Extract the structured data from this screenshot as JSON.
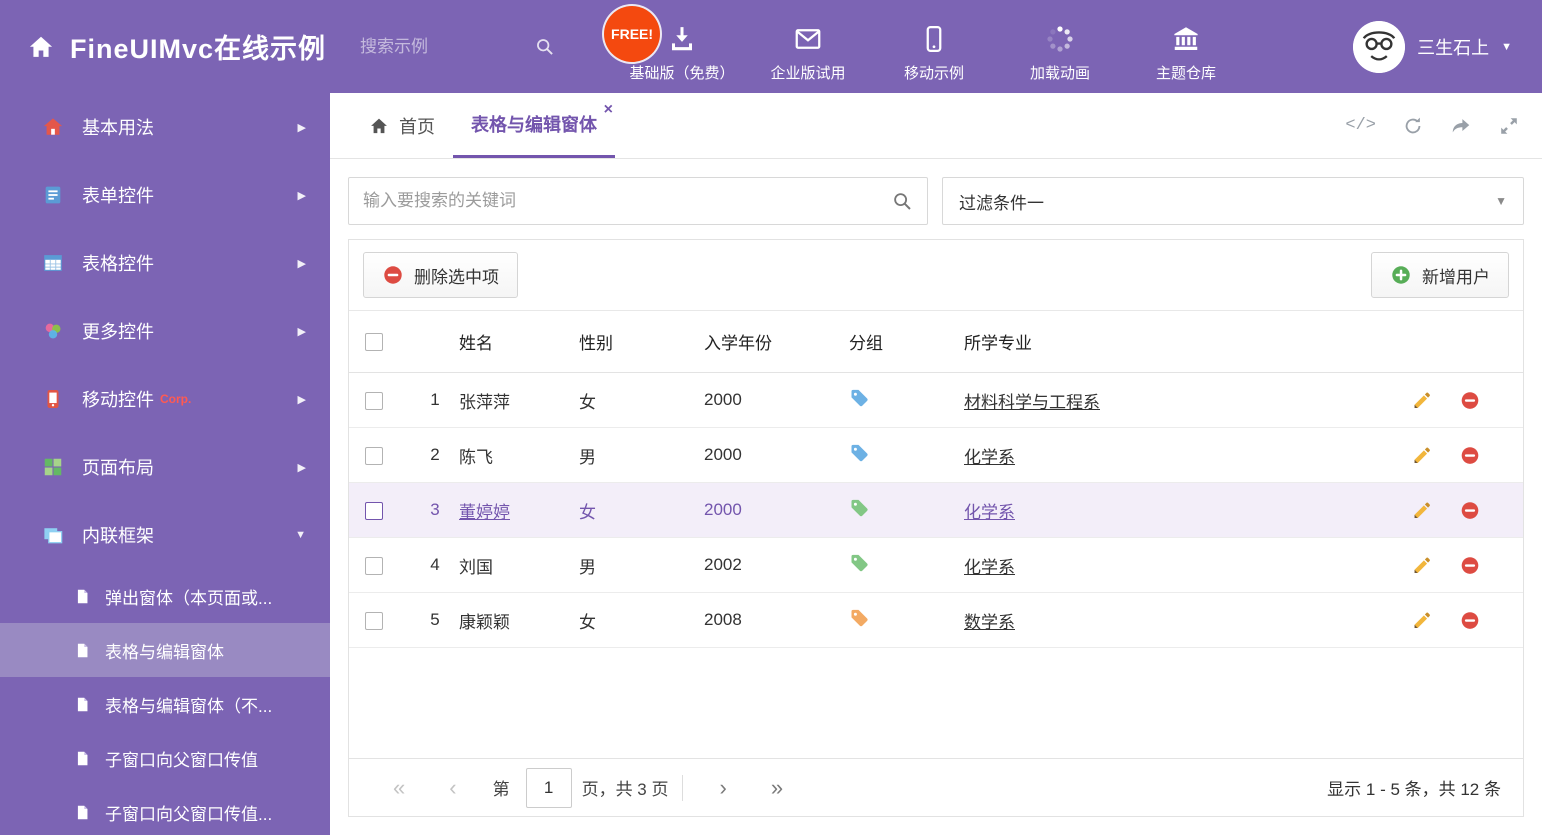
{
  "header": {
    "title": "FineUIMvc在线示例",
    "search_placeholder": "搜索示例",
    "free_badge": "FREE!",
    "nav": [
      {
        "label": "基础版（免费）",
        "icon": "download-icon"
      },
      {
        "label": "企业版试用",
        "icon": "envelope-icon"
      },
      {
        "label": "移动示例",
        "icon": "mobile-icon"
      },
      {
        "label": "加载动画",
        "icon": "spinner-icon"
      },
      {
        "label": "主题仓库",
        "icon": "bank-icon"
      }
    ],
    "user_name": "三生石上"
  },
  "sidebar": {
    "items": [
      {
        "label": "基本用法"
      },
      {
        "label": "表单控件"
      },
      {
        "label": "表格控件"
      },
      {
        "label": "更多控件"
      },
      {
        "label": "移动控件",
        "badge": "Corp."
      },
      {
        "label": "页面布局"
      },
      {
        "label": "内联框架"
      }
    ],
    "subitems": [
      {
        "label": "弹出窗体（本页面或..."
      },
      {
        "label": "表格与编辑窗体"
      },
      {
        "label": "表格与编辑窗体（不..."
      },
      {
        "label": "子窗口向父窗口传值"
      },
      {
        "label": "子窗口向父窗口传值..."
      }
    ]
  },
  "tabs": {
    "home_label": "首页",
    "active_label": "表格与编辑窗体"
  },
  "icons": {
    "close": "×",
    "code": "</>",
    "caret_down": "▼",
    "chevron_right": "▶"
  },
  "filter": {
    "search_placeholder": "输入要搜索的关键词",
    "dropdown_value": "过滤条件一"
  },
  "toolbar": {
    "delete_label": "删除选中项",
    "add_label": "新增用户"
  },
  "table": {
    "headers": {
      "name": "姓名",
      "gender": "性别",
      "year": "入学年份",
      "group": "分组",
      "major": "所学专业"
    },
    "rows": [
      {
        "num": "1",
        "name": "张萍萍",
        "gender": "女",
        "year": "2000",
        "major": "材料科学与工程系",
        "tag_color": "#6db1e4",
        "selected": false
      },
      {
        "num": "2",
        "name": "陈飞",
        "gender": "男",
        "year": "2000",
        "major": "化学系",
        "tag_color": "#6db1e4",
        "selected": false
      },
      {
        "num": "3",
        "name": "董婷婷",
        "gender": "女",
        "year": "2000",
        "major": "化学系",
        "tag_color": "#82c785",
        "selected": true
      },
      {
        "num": "4",
        "name": "刘国",
        "gender": "男",
        "year": "2002",
        "major": "化学系",
        "tag_color": "#82c785",
        "selected": false
      },
      {
        "num": "5",
        "name": "康颖颖",
        "gender": "女",
        "year": "2008",
        "major": "数学系",
        "tag_color": "#f3aa63",
        "selected": false
      }
    ]
  },
  "pagination": {
    "first_glyph": "«",
    "prev_glyph": "‹",
    "page_prefix": "第",
    "current_page": "1",
    "page_suffix": "页，共 3 页",
    "next_glyph": "›",
    "last_glyph": "»",
    "summary": "显示 1 - 5 条，共 12 条"
  },
  "colors": {
    "accent_purple": "#7c64b4",
    "active_subitem_bg": "#998ac2",
    "selected_row_bg": "#f3eef9",
    "selected_row_text": "#7355ad",
    "danger_red": "#dd4b42",
    "success_green": "#57ad57",
    "free_badge_bg": "#f4490f"
  }
}
